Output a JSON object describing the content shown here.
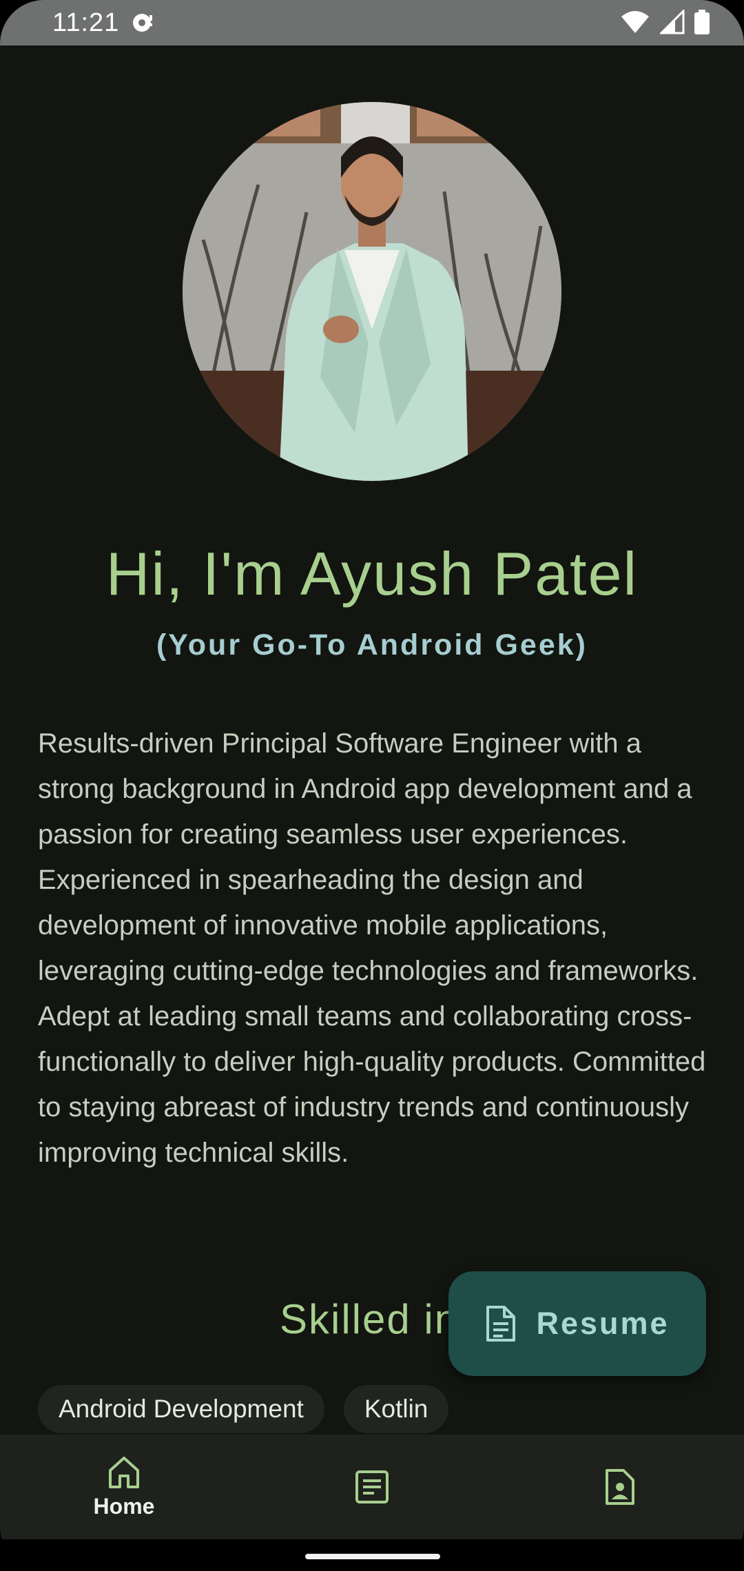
{
  "status": {
    "time": "11:21",
    "icons": [
      "cast-icon",
      "wifi-icon",
      "signal-icon",
      "battery-icon"
    ]
  },
  "profile": {
    "photo_alt": "Ayush Patel",
    "title": "Hi, I'm Ayush Patel",
    "subtitle": "(Your Go-To Android Geek)",
    "bio": "Results-driven Principal Software Engineer  with a strong background in Android app development and a passion for creating seamless user experiences. Experienced in spearheading the design and development of innovative mobile applications, leveraging cutting-edge technologies and frameworks. Adept at leading small teams and collaborating cross-functionally to deliver high-quality products. Committed to staying abreast of industry trends and continuously improving technical skills."
  },
  "skills": {
    "heading": "Skilled in",
    "chips": [
      "Android Development",
      "Kotlin"
    ]
  },
  "fab": {
    "label": "Resume",
    "icon": "document-icon"
  },
  "nav": {
    "items": [
      {
        "label": "Home",
        "icon": "home-icon",
        "selected": true
      },
      {
        "label": "",
        "icon": "article-icon",
        "selected": false
      },
      {
        "label": "",
        "icon": "contact-icon",
        "selected": false
      }
    ]
  },
  "colors": {
    "background": "#121510",
    "accent_green": "#a8cf8e",
    "accent_teal": "#a6cdd0",
    "fab_bg": "#1f4d48"
  }
}
